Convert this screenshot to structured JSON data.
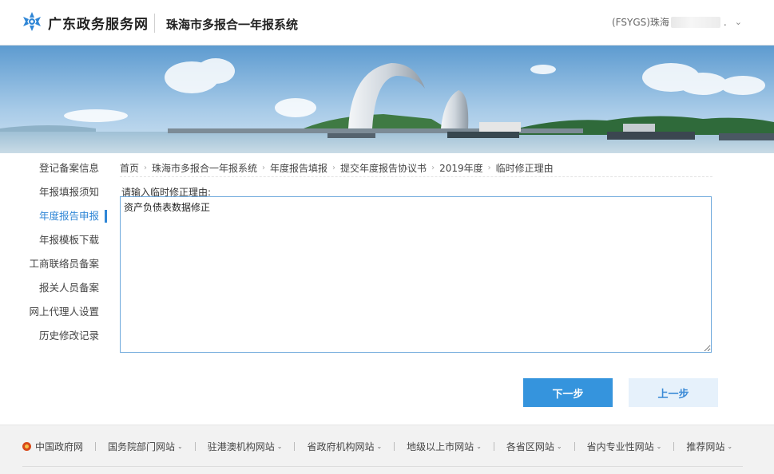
{
  "header": {
    "brand": "广东政务服务网",
    "system_title": "珠海市多报合一年报系统",
    "user_prefix": "(FSYGS)珠海",
    "user_suffix": "."
  },
  "sidebar": {
    "items": [
      {
        "label": "登记备案信息"
      },
      {
        "label": "年报填报须知"
      },
      {
        "label": "年度报告申报",
        "active": true
      },
      {
        "label": "年报模板下载"
      },
      {
        "label": "工商联络员备案"
      },
      {
        "label": "报关人员备案"
      },
      {
        "label": "网上代理人设置"
      },
      {
        "label": "历史修改记录"
      }
    ]
  },
  "breadcrumb": [
    "首页",
    "珠海市多报合一年报系统",
    "年度报告填报",
    "提交年度报告协议书",
    "2019年度",
    "临时修正理由"
  ],
  "form": {
    "label": "请输入临时修正理由:",
    "value": "资产负债表数据修正"
  },
  "buttons": {
    "next": "下一步",
    "prev": "上一步"
  },
  "footer": {
    "links": [
      {
        "label": "中国政府网",
        "dropdown": false
      },
      {
        "label": "国务院部门网站",
        "dropdown": true
      },
      {
        "label": "驻港澳机构网站",
        "dropdown": true
      },
      {
        "label": "省政府机构网站",
        "dropdown": true
      },
      {
        "label": "地级以上市网站",
        "dropdown": true
      },
      {
        "label": "各省区网站",
        "dropdown": true
      },
      {
        "label": "省内专业性网站",
        "dropdown": true
      },
      {
        "label": "推荐网站",
        "dropdown": true
      }
    ]
  },
  "colors": {
    "accent": "#3594dd",
    "active_nav": "#2f86d6"
  }
}
